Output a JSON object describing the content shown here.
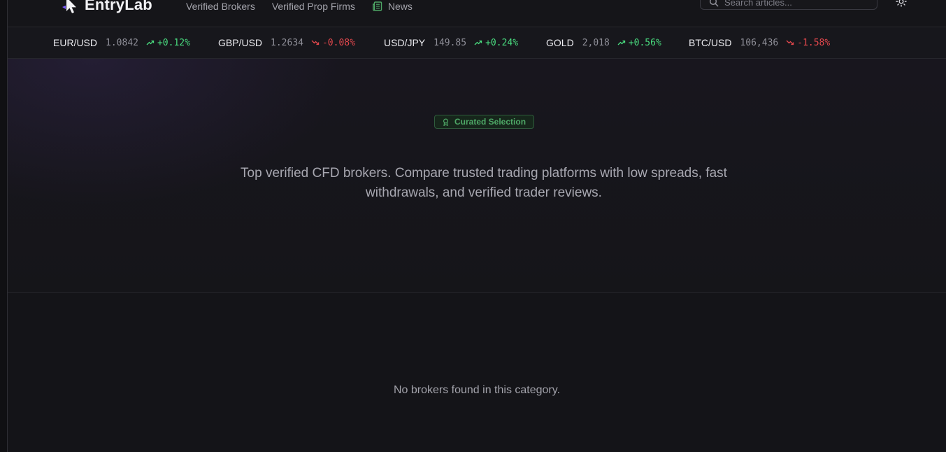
{
  "header": {
    "logo_text": "EntryLab",
    "nav": {
      "verified_brokers": "Verified Brokers",
      "verified_prop_firms": "Verified Prop Firms",
      "news": "News"
    },
    "search": {
      "placeholder": "Search articles..."
    },
    "icons": {
      "logo": "cursor-arrow-logo",
      "news": "newspaper-icon",
      "search": "search-icon",
      "theme": "sun-icon"
    }
  },
  "ticker": [
    {
      "symbol": "EUR/USD",
      "price": "1.0842",
      "change": "+0.12%",
      "direction": "up"
    },
    {
      "symbol": "GBP/USD",
      "price": "1.2634",
      "change": "-0.08%",
      "direction": "down"
    },
    {
      "symbol": "USD/JPY",
      "price": "149.85",
      "change": "+0.24%",
      "direction": "up"
    },
    {
      "symbol": "GOLD",
      "price": "2,018",
      "change": "+0.56%",
      "direction": "up"
    },
    {
      "symbol": "BTC/USD",
      "price": "106,436",
      "change": "-1.58%",
      "direction": "down"
    }
  ],
  "hero": {
    "badge_label": "Curated Selection",
    "badge_icon": "award-icon",
    "description": "Top verified CFD brokers. Compare trusted trading platforms with low spreads, fast withdrawals, and verified trader reviews."
  },
  "results": {
    "empty_message": "No brokers found in this category."
  },
  "colors": {
    "background": "#141418",
    "positive": "#4ade80",
    "negative": "#e5484d",
    "badge_green": "#4ea766",
    "text_muted": "#a3a3ab"
  }
}
